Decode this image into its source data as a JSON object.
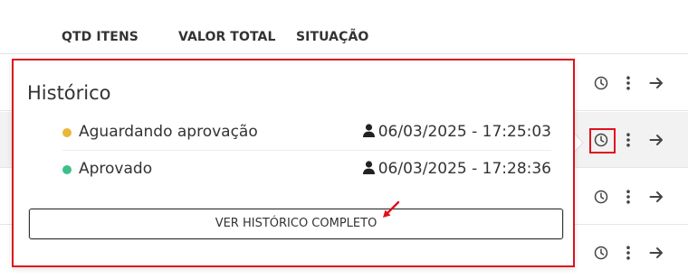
{
  "table": {
    "columns": [
      "QTD ITENS",
      "VALOR TOTAL",
      "SITUAÇÃO"
    ],
    "row_actions": {
      "clock_icon": "clock-icon",
      "menu_icon": "kebab-menu-icon",
      "open_icon": "arrow-right-icon"
    }
  },
  "popover": {
    "title": "Histórico",
    "items": [
      {
        "status": "Aguardando aprovação",
        "datetime": "06/03/2025 - 17:25:03",
        "dot_color": "#e8b83a",
        "icon": "user-icon"
      },
      {
        "status": "Aprovado",
        "datetime": "06/03/2025 - 17:28:36",
        "dot_color": "#3cc08a",
        "icon": "user-icon"
      }
    ],
    "button_label": "VER HISTÓRICO COMPLETO"
  },
  "colors": {
    "highlight": "#e0101e",
    "text": "#333333",
    "selected_row": "#f2f2f2"
  }
}
